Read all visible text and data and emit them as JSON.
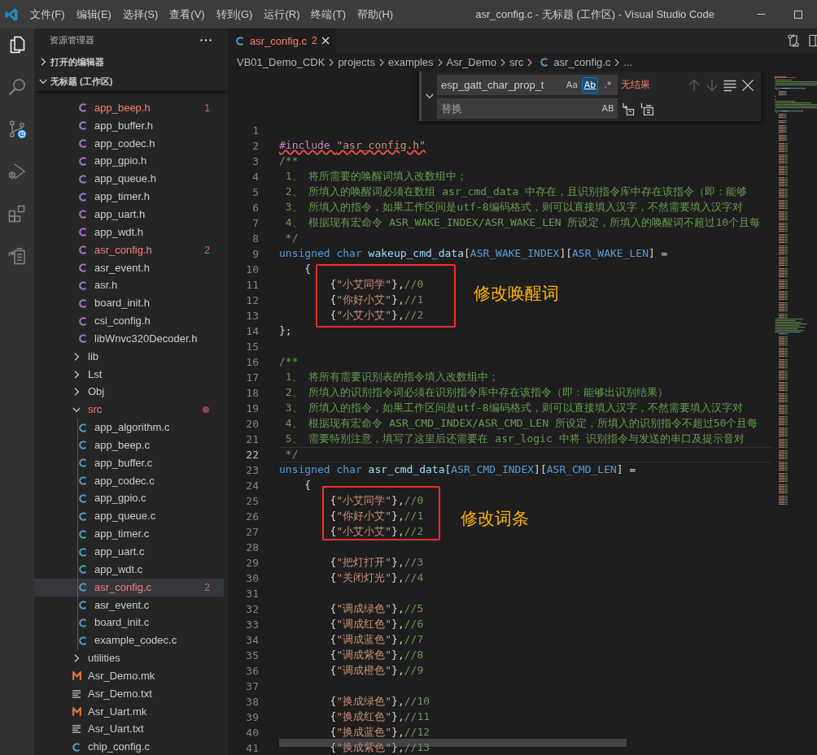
{
  "window": {
    "title": "asr_config.c - 无标题 (工作区) - Visual Studio Code",
    "menu": [
      "文件(F)",
      "编辑(E)",
      "选择(S)",
      "查看(V)",
      "转到(G)",
      "运行(R)",
      "终端(T)",
      "帮助(H)"
    ]
  },
  "activity_bar": [
    {
      "kind": "explorer",
      "selected": true
    },
    {
      "kind": "search",
      "selected": false
    },
    {
      "kind": "source-control",
      "selected": false
    },
    {
      "kind": "debug",
      "selected": false
    },
    {
      "kind": "extensions",
      "selected": false
    },
    {
      "kind": "clipboard",
      "selected": false
    }
  ],
  "sidebar": {
    "title": "资源管理器",
    "sections": [
      {
        "label": "打开的编辑器",
        "expanded": false
      },
      {
        "label": "无标题 (工作区)",
        "expanded": true,
        "tree": [
          {
            "children": [
              {
                "label": "app_beep.h",
                "kind": "c-header",
                "has_errors": true,
                "badge": "1",
                "selected": false
              },
              {
                "label": "app_buffer.h",
                "kind": "c-header",
                "has_errors": false,
                "selected": false
              },
              {
                "label": "app_codec.h",
                "kind": "c-header",
                "has_errors": false,
                "selected": false
              },
              {
                "label": "app_gpio.h",
                "kind": "c-header",
                "has_errors": false,
                "selected": false
              },
              {
                "label": "app_queue.h",
                "kind": "c-header",
                "has_errors": false,
                "selected": false
              },
              {
                "label": "app_timer.h",
                "kind": "c-header",
                "has_errors": false,
                "selected": false
              },
              {
                "label": "app_uart.h",
                "kind": "c-header",
                "has_errors": false,
                "selected": false
              },
              {
                "label": "app_wdt.h",
                "kind": "c-header",
                "has_errors": false,
                "selected": false
              },
              {
                "label": "asr_config.h",
                "kind": "c-header",
                "has_errors": true,
                "badge": "2",
                "selected": false
              },
              {
                "label": "asr_event.h",
                "kind": "c-header",
                "has_errors": false,
                "selected": false
              },
              {
                "label": "asr.h",
                "kind": "c-header",
                "has_errors": false,
                "selected": false
              },
              {
                "label": "board_init.h",
                "kind": "c-header",
                "has_errors": false,
                "selected": false
              },
              {
                "label": "csi_config.h",
                "kind": "c-header",
                "has_errors": false,
                "selected": false
              },
              {
                "label": "libWnvc320Decoder.h",
                "kind": "c-header",
                "has_errors": false,
                "selected": false
              }
            ]
          },
          {
            "label": "lib",
            "kind": "folder",
            "expanded": false,
            "has_errors": false,
            "selected": false
          },
          {
            "label": "Lst",
            "kind": "folder",
            "expanded": false,
            "has_errors": false,
            "selected": false
          },
          {
            "label": "Obj",
            "kind": "folder",
            "expanded": false,
            "has_errors": false,
            "selected": false
          },
          {
            "label": "src",
            "kind": "folder",
            "expanded": true,
            "has_errors": true,
            "selected": false,
            "children": [
              {
                "label": "app_algorithm.c",
                "kind": "c-source",
                "has_errors": false,
                "selected": false
              },
              {
                "label": "app_beep.c",
                "kind": "c-source",
                "has_errors": false,
                "selected": false
              },
              {
                "label": "app_buffer.c",
                "kind": "c-source",
                "has_errors": false,
                "selected": false
              },
              {
                "label": "app_codec.c",
                "kind": "c-source",
                "has_errors": false,
                "selected": false
              },
              {
                "label": "app_gpio.c",
                "kind": "c-source",
                "has_errors": false,
                "selected": false
              },
              {
                "label": "app_queue.c",
                "kind": "c-source",
                "has_errors": false,
                "selected": false
              },
              {
                "label": "app_timer.c",
                "kind": "c-source",
                "has_errors": false,
                "selected": false
              },
              {
                "label": "app_uart.c",
                "kind": "c-source",
                "has_errors": false,
                "selected": false
              },
              {
                "label": "app_wdt.c",
                "kind": "c-source",
                "has_errors": false,
                "selected": false
              },
              {
                "label": "asr_config.c",
                "kind": "c-source",
                "has_errors": true,
                "badge": "2",
                "selected": true
              },
              {
                "label": "asr_event.c",
                "kind": "c-source",
                "has_errors": false,
                "selected": false
              },
              {
                "label": "board_init.c",
                "kind": "c-source",
                "has_errors": false,
                "selected": false
              },
              {
                "label": "example_codec.c",
                "kind": "c-source",
                "has_errors": false,
                "selected": false
              }
            ]
          },
          {
            "label": "utilities",
            "kind": "folder",
            "expanded": false,
            "has_errors": false,
            "selected": false
          },
          {
            "label": "Asr_Demo.mk",
            "kind": "makefile",
            "has_errors": false,
            "selected": false
          },
          {
            "label": "Asr_Demo.txt",
            "kind": "text",
            "has_errors": false,
            "selected": false
          },
          {
            "label": "Asr_Uart.mk",
            "kind": "makefile",
            "has_errors": false,
            "selected": false
          },
          {
            "label": "Asr_Uart.txt",
            "kind": "text",
            "has_errors": false,
            "selected": false
          },
          {
            "label": "chip_config.c",
            "kind": "c-source",
            "has_errors": false,
            "selected": false
          }
        ]
      }
    ]
  },
  "editor": {
    "tabs": [
      {
        "label": "asr_config.c",
        "kind": "c-source",
        "badge": "2",
        "has_errors": true,
        "selected": true
      }
    ],
    "breadcrumbs": [
      {
        "label": "VB01_Demo_CDK",
        "kind": "folder"
      },
      {
        "label": "projects",
        "kind": "folder"
      },
      {
        "label": "examples",
        "kind": "folder"
      },
      {
        "label": "Asr_Demo",
        "kind": "folder"
      },
      {
        "label": "src",
        "kind": "folder"
      },
      {
        "label": "asr_config.c",
        "kind": "c-source"
      },
      {
        "label": "...",
        "kind": "symbol"
      }
    ],
    "find": {
      "expanded": true,
      "value": "esp_gatt_char_prop_t",
      "options": [
        {
          "kind": "match-case",
          "label": "Aa",
          "on": false
        },
        {
          "kind": "whole-word",
          "label": "Ab",
          "on": true
        },
        {
          "kind": "regex",
          "label": ".*",
          "on": false
        }
      ],
      "result": "无结果",
      "buttons": [
        {
          "kind": "previous",
          "disabled": true
        },
        {
          "kind": "next",
          "disabled": true
        },
        {
          "kind": "find-in-selection",
          "disabled": false
        },
        {
          "kind": "close",
          "disabled": false
        }
      ],
      "replace": {
        "placeholder": "替换",
        "options": [
          {
            "kind": "preserve-case",
            "label": "AB",
            "on": false
          }
        ],
        "buttons": [
          {
            "kind": "replace",
            "disabled": false
          },
          {
            "kind": "replace-all",
            "disabled": false
          }
        ]
      }
    },
    "lines": [
      {
        "n": "1",
        "current": false
      },
      {
        "n": "2",
        "current": false,
        "error": true,
        "kind": "statement",
        "tokens": [
          {
            "kind": "preprocessor",
            "text": "#include "
          },
          {
            "kind": "string",
            "text": "\"asr_config.h\""
          }
        ]
      },
      {
        "n": "3",
        "current": false,
        "error": false,
        "kind": "statement",
        "tokens": [
          {
            "kind": "comment",
            "text": "/**"
          }
        ]
      },
      {
        "n": "4",
        "current": false,
        "error": false,
        "kind": "doc",
        "tokens": [
          {
            "kind": "comment",
            "text": "1、 将所需要的唤醒词填入改数组中；"
          }
        ]
      },
      {
        "n": "5",
        "current": false,
        "error": false,
        "kind": "doc",
        "tokens": [
          {
            "kind": "comment",
            "text": "2、 所填入的唤醒词必须在数组 asr_cmd_data 中存在，且识别指令库中存在该指令（即：能够"
          }
        ]
      },
      {
        "n": "6",
        "current": false,
        "error": false,
        "kind": "doc",
        "tokens": [
          {
            "kind": "comment",
            "text": "3、 所填入的指令，如果工作区间是utf-8编码格式，则可以直接填入汉字，不然需要填入汉字对"
          }
        ]
      },
      {
        "n": "7",
        "current": false,
        "error": false,
        "kind": "doc",
        "tokens": [
          {
            "kind": "comment",
            "text": "4、 根据现有宏命令 ASR_WAKE_INDEX/ASR_WAKE_LEN 所设定，所填入的唤醒词不超过10个且每"
          }
        ]
      },
      {
        "n": "8",
        "current": false,
        "error": false,
        "kind": "doc",
        "tokens": [
          {
            "kind": "comment",
            "text": "*/"
          }
        ]
      },
      {
        "n": "9",
        "current": false,
        "error": false,
        "kind": "statement",
        "tokens": [
          {
            "kind": "keyword",
            "text": "unsigned char "
          },
          {
            "kind": "variable",
            "text": "wakeup_cmd_data"
          },
          {
            "kind": "plain",
            "text": "["
          },
          {
            "kind": "macro",
            "text": "ASR_WAKE_INDEX"
          },
          {
            "kind": "plain",
            "text": "]["
          },
          {
            "kind": "macro",
            "text": "ASR_WAKE_LEN"
          },
          {
            "kind": "plain",
            "text": "] ="
          }
        ]
      },
      {
        "n": "10",
        "current": false,
        "error": false,
        "kind": "brace",
        "tokens": [
          {
            "kind": "plain",
            "text": "{"
          }
        ]
      },
      {
        "n": "11",
        "current": false,
        "error": false,
        "kind": "entry",
        "tokens": [
          {
            "kind": "plain",
            "text": "{"
          },
          {
            "kind": "string",
            "text": "\"小艾同学\""
          },
          {
            "kind": "plain",
            "text": "},"
          },
          {
            "kind": "comment",
            "text": "//0"
          }
        ]
      },
      {
        "n": "12",
        "current": false,
        "error": false,
        "kind": "entry",
        "tokens": [
          {
            "kind": "plain",
            "text": "{"
          },
          {
            "kind": "string",
            "text": "\"你好小艾\""
          },
          {
            "kind": "plain",
            "text": "},"
          },
          {
            "kind": "comment",
            "text": "//1"
          }
        ]
      },
      {
        "n": "13",
        "current": false,
        "error": false,
        "kind": "entry",
        "tokens": [
          {
            "kind": "plain",
            "text": "{"
          },
          {
            "kind": "string",
            "text": "\"小艾小艾\""
          },
          {
            "kind": "plain",
            "text": "},"
          },
          {
            "kind": "comment",
            "text": "//2"
          }
        ]
      },
      {
        "n": "14",
        "current": false,
        "error": false,
        "kind": "statement",
        "tokens": [
          {
            "kind": "plain",
            "text": "};"
          }
        ]
      },
      {
        "n": "15",
        "current": false
      },
      {
        "n": "16",
        "current": false,
        "error": false,
        "kind": "statement",
        "tokens": [
          {
            "kind": "comment",
            "text": "/**"
          }
        ]
      },
      {
        "n": "17",
        "current": false,
        "error": false,
        "kind": "doc",
        "tokens": [
          {
            "kind": "comment",
            "text": "1、 将所有需要识别表的指令填入改数组中；"
          }
        ]
      },
      {
        "n": "18",
        "current": false,
        "error": false,
        "kind": "doc",
        "tokens": [
          {
            "kind": "comment",
            "text": "2、 所填入的识别指令词必须在识别指令库中存在该指令（即：能够出识别结果）"
          }
        ]
      },
      {
        "n": "19",
        "current": false,
        "error": false,
        "kind": "doc",
        "tokens": [
          {
            "kind": "comment",
            "text": "3、 所填入的指令，如果工作区间是utf-8编码格式，则可以直接填入汉字，不然需要填入汉字对"
          }
        ]
      },
      {
        "n": "20",
        "current": false,
        "error": false,
        "kind": "doc",
        "tokens": [
          {
            "kind": "comment",
            "text": "4、 根据现有宏命令 ASR_CMD_INDEX/ASR_CMD_LEN 所设定，所填入的识别指令不超过50个且每"
          }
        ]
      },
      {
        "n": "21",
        "current": false,
        "error": false,
        "kind": "doc",
        "tokens": [
          {
            "kind": "comment",
            "text": "5、 需要特别注意，填写了这里后还需要在 asr_logic 中将 识别指令与发送的串口及提示音对"
          }
        ]
      },
      {
        "n": "22",
        "current": true,
        "error": false,
        "kind": "doc",
        "tokens": [
          {
            "kind": "comment",
            "text": "*/"
          }
        ]
      },
      {
        "n": "23",
        "current": false,
        "error": false,
        "kind": "statement",
        "tokens": [
          {
            "kind": "keyword",
            "text": "unsigned char "
          },
          {
            "kind": "variable",
            "text": "asr_cmd_data"
          },
          {
            "kind": "plain",
            "text": "["
          },
          {
            "kind": "macro",
            "text": "ASR_CMD_INDEX"
          },
          {
            "kind": "plain",
            "text": "]["
          },
          {
            "kind": "macro",
            "text": "ASR_CMD_LEN"
          },
          {
            "kind": "plain",
            "text": "] ="
          }
        ]
      },
      {
        "n": "24",
        "current": false,
        "error": false,
        "kind": "brace",
        "tokens": [
          {
            "kind": "plain",
            "text": "{"
          }
        ]
      },
      {
        "n": "25",
        "current": false,
        "error": false,
        "kind": "entry",
        "tokens": [
          {
            "kind": "plain",
            "text": "{"
          },
          {
            "kind": "string",
            "text": "\"小艾同学\""
          },
          {
            "kind": "plain",
            "text": "},"
          },
          {
            "kind": "comment",
            "text": "//0"
          }
        ]
      },
      {
        "n": "26",
        "current": false,
        "error": false,
        "kind": "entry",
        "tokens": [
          {
            "kind": "plain",
            "text": "{"
          },
          {
            "kind": "string",
            "text": "\"你好小艾\""
          },
          {
            "kind": "plain",
            "text": "},"
          },
          {
            "kind": "comment",
            "text": "//1"
          }
        ]
      },
      {
        "n": "27",
        "current": false,
        "error": false,
        "kind": "entry",
        "tokens": [
          {
            "kind": "plain",
            "text": "{"
          },
          {
            "kind": "string",
            "text": "\"小艾小艾\""
          },
          {
            "kind": "plain",
            "text": "},"
          },
          {
            "kind": "comment",
            "text": "//2"
          }
        ]
      },
      {
        "n": "28",
        "current": false
      },
      {
        "n": "29",
        "current": false,
        "error": false,
        "kind": "entry",
        "tokens": [
          {
            "kind": "plain",
            "text": "{"
          },
          {
            "kind": "string",
            "text": "\"把灯打开\""
          },
          {
            "kind": "plain",
            "text": "},"
          },
          {
            "kind": "comment",
            "text": "//3"
          }
        ]
      },
      {
        "n": "30",
        "current": false,
        "error": false,
        "kind": "entry",
        "tokens": [
          {
            "kind": "plain",
            "text": "{"
          },
          {
            "kind": "string",
            "text": "\"关闭灯光\""
          },
          {
            "kind": "plain",
            "text": "},"
          },
          {
            "kind": "comment",
            "text": "//4"
          }
        ]
      },
      {
        "n": "31",
        "current": false
      },
      {
        "n": "32",
        "current": false,
        "error": false,
        "kind": "entry",
        "tokens": [
          {
            "kind": "plain",
            "text": "{"
          },
          {
            "kind": "string",
            "text": "\"调成绿色\""
          },
          {
            "kind": "plain",
            "text": "},"
          },
          {
            "kind": "comment",
            "text": "//5"
          }
        ]
      },
      {
        "n": "33",
        "current": false,
        "error": false,
        "kind": "entry",
        "tokens": [
          {
            "kind": "plain",
            "text": "{"
          },
          {
            "kind": "string",
            "text": "\"调成红色\""
          },
          {
            "kind": "plain",
            "text": "},"
          },
          {
            "kind": "comment",
            "text": "//6"
          }
        ]
      },
      {
        "n": "34",
        "current": false,
        "error": false,
        "kind": "entry",
        "tokens": [
          {
            "kind": "plain",
            "text": "{"
          },
          {
            "kind": "string",
            "text": "\"调成蓝色\""
          },
          {
            "kind": "plain",
            "text": "},"
          },
          {
            "kind": "comment",
            "text": "//7"
          }
        ]
      },
      {
        "n": "35",
        "current": false,
        "error": false,
        "kind": "entry",
        "tokens": [
          {
            "kind": "plain",
            "text": "{"
          },
          {
            "kind": "string",
            "text": "\"调成紫色\""
          },
          {
            "kind": "plain",
            "text": "},"
          },
          {
            "kind": "comment",
            "text": "//8"
          }
        ]
      },
      {
        "n": "36",
        "current": false,
        "error": false,
        "kind": "entry",
        "tokens": [
          {
            "kind": "plain",
            "text": "{"
          },
          {
            "kind": "string",
            "text": "\"调成橙色\""
          },
          {
            "kind": "plain",
            "text": "},"
          },
          {
            "kind": "comment",
            "text": "//9"
          }
        ]
      },
      {
        "n": "37",
        "current": false
      },
      {
        "n": "38",
        "current": false,
        "error": false,
        "kind": "entry",
        "tokens": [
          {
            "kind": "plain",
            "text": "{"
          },
          {
            "kind": "string",
            "text": "\"换成绿色\""
          },
          {
            "kind": "plain",
            "text": "},"
          },
          {
            "kind": "comment",
            "text": "//10"
          }
        ]
      },
      {
        "n": "39",
        "current": false,
        "error": false,
        "kind": "entry",
        "tokens": [
          {
            "kind": "plain",
            "text": "{"
          },
          {
            "kind": "string",
            "text": "\"换成红色\""
          },
          {
            "kind": "plain",
            "text": "},"
          },
          {
            "kind": "comment",
            "text": "//11"
          }
        ]
      },
      {
        "n": "40",
        "current": false,
        "error": false,
        "kind": "entry",
        "tokens": [
          {
            "kind": "plain",
            "text": "{"
          },
          {
            "kind": "string",
            "text": "\"换成蓝色\""
          },
          {
            "kind": "plain",
            "text": "},"
          },
          {
            "kind": "comment",
            "text": "//12"
          }
        ]
      },
      {
        "n": "41",
        "current": false,
        "error": false,
        "kind": "entry",
        "tokens": [
          {
            "kind": "plain",
            "text": "{"
          },
          {
            "kind": "string",
            "text": "\"换成紫色\""
          },
          {
            "kind": "plain",
            "text": "},"
          },
          {
            "kind": "comment",
            "text": "//13"
          }
        ]
      }
    ],
    "annotations": [
      {
        "text": "修改唤醒词"
      },
      {
        "text": "修改词条"
      }
    ]
  }
}
